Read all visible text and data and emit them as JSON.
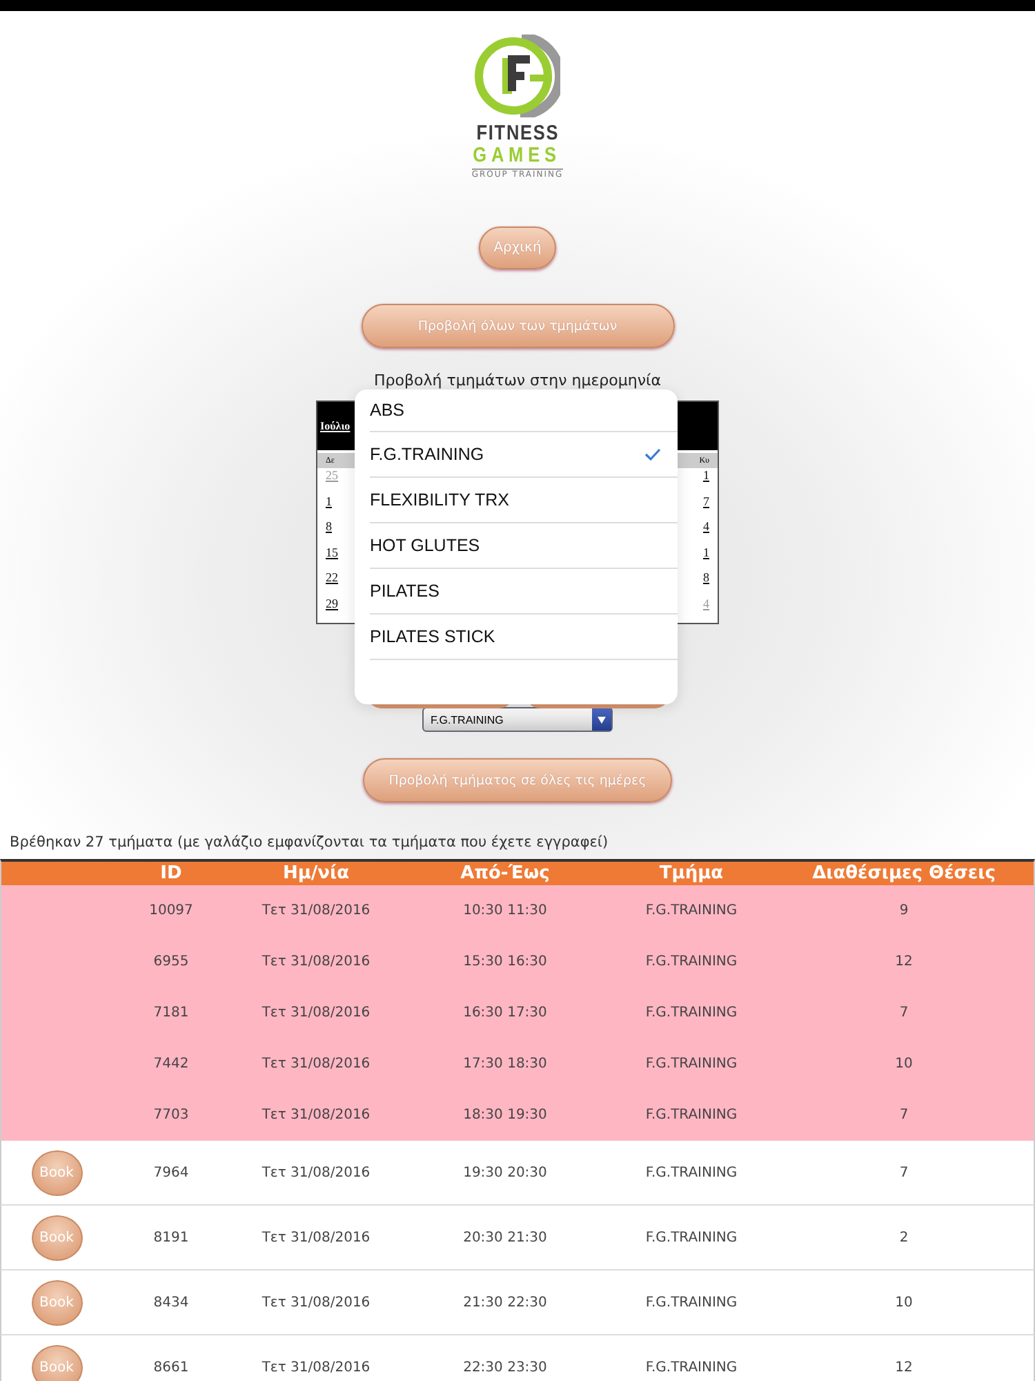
{
  "logo": {
    "line_1": "FITNESS",
    "line_2": "GAMES",
    "line_3": "GROUP TRAINING"
  },
  "home_button": "Αρχική",
  "all_classes_button": "Προβολή όλων των τμημάτων",
  "date_label": "Προβολή τμημάτων στην ημερομηνία",
  "calendar": {
    "month": "Ιούλιο",
    "first_weekday": "Δε",
    "last_weekday": "Κυ",
    "first_column": [
      {
        "day": "25",
        "other_month": true
      },
      {
        "day": "1",
        "other_month": false
      },
      {
        "day": "8",
        "other_month": false
      },
      {
        "day": "15",
        "other_month": false
      },
      {
        "day": "22",
        "other_month": false
      },
      {
        "day": "29",
        "other_month": false
      }
    ],
    "last_column": [
      {
        "day": "1",
        "other_month": false
      },
      {
        "day": "7",
        "other_month": false
      },
      {
        "day": "4",
        "other_month": false
      },
      {
        "day": "1",
        "other_month": false
      },
      {
        "day": "8",
        "other_month": false
      },
      {
        "day": "4",
        "other_month": true
      }
    ]
  },
  "picker": {
    "options": [
      {
        "label": "ABS",
        "selected": false
      },
      {
        "label": "F.G.TRAINING",
        "selected": true
      },
      {
        "label": "FLEXIBILITY TRX",
        "selected": false
      },
      {
        "label": "HOT GLUTES",
        "selected": false
      },
      {
        "label": "PILATES",
        "selected": false
      },
      {
        "label": "PILATES STICK",
        "selected": false
      }
    ]
  },
  "class_select": {
    "value": "F.G.TRAINING"
  },
  "all_days_button": "Προβολή τμήματος σε όλες τις ημέρες",
  "result_text": "Βρέθηκαν 27 τμήματα (με γαλάζιο εμφανίζονται τα τμήματα που έχετε εγγραφεί)",
  "table": {
    "columns": [
      "",
      "ID",
      "Ημ/νία",
      "Από-Έως",
      "Τμήμα",
      "Διαθέσιμες Θέσεις"
    ],
    "rows": [
      {
        "registered": true,
        "id": "10097",
        "date": "Τετ 31/08/2016",
        "time": "10:30 11:30",
        "class": "F.G.TRAINING",
        "seats": "9"
      },
      {
        "registered": true,
        "id": "6955",
        "date": "Τετ 31/08/2016",
        "time": "15:30 16:30",
        "class": "F.G.TRAINING",
        "seats": "12"
      },
      {
        "registered": true,
        "id": "7181",
        "date": "Τετ 31/08/2016",
        "time": "16:30 17:30",
        "class": "F.G.TRAINING",
        "seats": "7"
      },
      {
        "registered": true,
        "id": "7442",
        "date": "Τετ 31/08/2016",
        "time": "17:30 18:30",
        "class": "F.G.TRAINING",
        "seats": "10"
      },
      {
        "registered": true,
        "id": "7703",
        "date": "Τετ 31/08/2016",
        "time": "18:30 19:30",
        "class": "F.G.TRAINING",
        "seats": "7"
      },
      {
        "registered": false,
        "book": "Book",
        "id": "7964",
        "date": "Τετ 31/08/2016",
        "time": "19:30 20:30",
        "class": "F.G.TRAINING",
        "seats": "7"
      },
      {
        "registered": false,
        "book": "Book",
        "id": "8191",
        "date": "Τετ 31/08/2016",
        "time": "20:30 21:30",
        "class": "F.G.TRAINING",
        "seats": "2"
      },
      {
        "registered": false,
        "book": "Book",
        "id": "8434",
        "date": "Τετ 31/08/2016",
        "time": "21:30 22:30",
        "class": "F.G.TRAINING",
        "seats": "10"
      },
      {
        "registered": false,
        "book": "Book",
        "id": "8661",
        "date": "Τετ 31/08/2016",
        "time": "22:30 23:30",
        "class": "F.G.TRAINING",
        "seats": "12"
      }
    ]
  }
}
